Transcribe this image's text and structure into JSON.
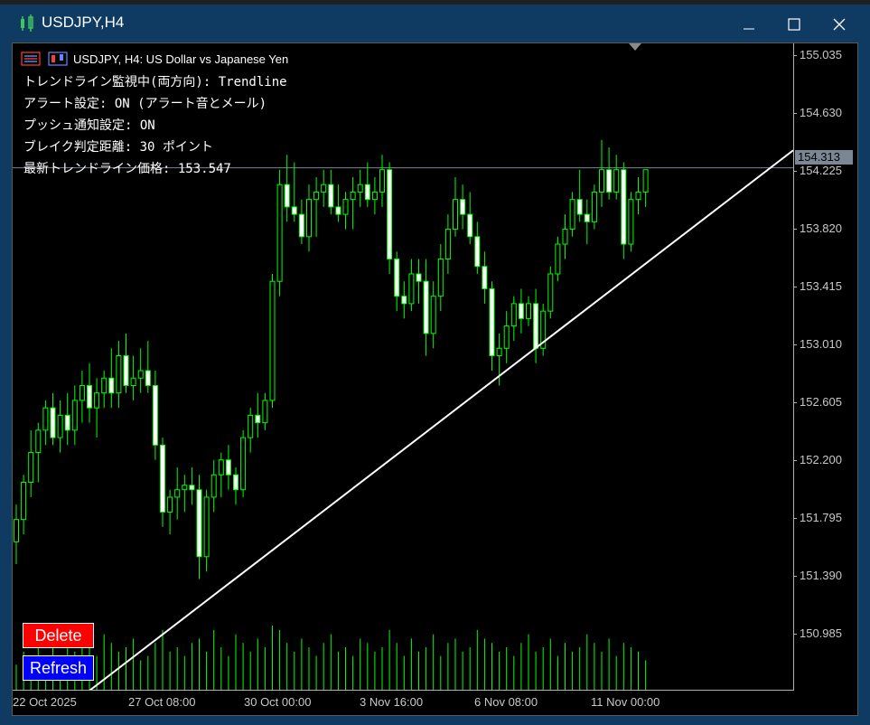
{
  "window": {
    "title": "USDJPY,H4",
    "minimize_icon": "minimize-icon",
    "maximize_icon": "maximize-icon",
    "close_icon": "close-icon"
  },
  "chart": {
    "symbol_line": "USDJPY, H4:  US Dollar vs Japanese Yen",
    "current_price": "154.313",
    "colors": {
      "candle": "#00ff00",
      "trendline": "#ffffff",
      "background": "#000000",
      "volume": "#00ff00"
    }
  },
  "info_lines": [
    "トレンドライン監視中(両方向): Trendline",
    "アラート設定: ON (アラート音とメール)",
    "プッシュ通知設定: ON",
    "ブレイク判定距離: 30 ポイント",
    "最新トレンドライン価格: 153.547"
  ],
  "buttons": {
    "delete": "Delete",
    "refresh": "Refresh"
  },
  "price_axis": [
    "155.035",
    "154.630",
    "154.225",
    "153.820",
    "153.415",
    "153.010",
    "152.605",
    "152.200",
    "151.795",
    "151.390",
    "150.985"
  ],
  "time_axis": [
    "22 Oct 2025",
    "27 Oct 08:00",
    "30 Oct 00:00",
    "3 Nov 16:00",
    "6 Nov 08:00",
    "11 Nov 00:00"
  ],
  "chart_data": {
    "type": "candlestick",
    "series": [
      {
        "ohlc": [
          [
            151.8,
            152.05,
            151.65,
            151.95
          ],
          [
            151.95,
            152.25,
            151.85,
            152.2
          ],
          [
            152.2,
            152.55,
            152.1,
            152.4
          ],
          [
            152.4,
            152.6,
            152.2,
            152.55
          ],
          [
            152.55,
            152.75,
            152.45,
            152.7
          ],
          [
            152.7,
            152.8,
            152.45,
            152.5
          ],
          [
            152.5,
            152.75,
            152.4,
            152.65
          ],
          [
            152.65,
            152.8,
            152.45,
            152.55
          ],
          [
            152.55,
            152.85,
            152.45,
            152.75
          ],
          [
            152.75,
            152.95,
            152.6,
            152.85
          ],
          [
            152.85,
            153.0,
            152.6,
            152.7
          ],
          [
            152.7,
            152.9,
            152.5,
            152.8
          ],
          [
            152.8,
            152.95,
            152.7,
            152.9
          ],
          [
            152.9,
            153.1,
            152.7,
            152.8
          ],
          [
            152.8,
            153.15,
            152.7,
            153.05
          ],
          [
            153.05,
            153.2,
            152.8,
            152.85
          ],
          [
            152.85,
            153.05,
            152.75,
            152.9
          ],
          [
            152.9,
            153.1,
            152.8,
            152.95
          ],
          [
            152.95,
            153.15,
            152.8,
            152.85
          ],
          [
            152.85,
            152.95,
            152.35,
            152.45
          ],
          [
            152.45,
            152.5,
            151.9,
            152.0
          ],
          [
            152.0,
            152.15,
            151.85,
            152.1
          ],
          [
            152.1,
            152.3,
            151.95,
            152.15
          ],
          [
            152.15,
            152.25,
            152.0,
            152.18
          ],
          [
            152.18,
            152.3,
            152.05,
            152.15
          ],
          [
            152.15,
            152.25,
            151.55,
            151.7
          ],
          [
            151.7,
            152.15,
            151.6,
            152.1
          ],
          [
            152.1,
            152.35,
            152.0,
            152.25
          ],
          [
            152.25,
            152.4,
            152.1,
            152.35
          ],
          [
            152.35,
            152.45,
            152.15,
            152.25
          ],
          [
            152.25,
            152.3,
            152.05,
            152.15
          ],
          [
            152.15,
            152.55,
            152.1,
            152.5
          ],
          [
            152.5,
            152.7,
            152.4,
            152.65
          ],
          [
            152.65,
            152.8,
            152.5,
            152.6
          ],
          [
            152.6,
            152.8,
            152.55,
            152.75
          ],
          [
            152.75,
            153.6,
            152.7,
            153.55
          ],
          [
            153.55,
            154.3,
            153.45,
            154.2
          ],
          [
            154.2,
            154.4,
            153.95,
            154.05
          ],
          [
            154.05,
            154.35,
            153.95,
            154.0
          ],
          [
            154.0,
            154.1,
            153.8,
            153.85
          ],
          [
            153.85,
            154.2,
            153.75,
            154.1
          ],
          [
            154.1,
            154.25,
            153.85,
            154.15
          ],
          [
            154.15,
            154.3,
            154.05,
            154.2
          ],
          [
            154.2,
            154.3,
            154.0,
            154.05
          ],
          [
            154.05,
            154.2,
            153.95,
            154.0
          ],
          [
            154.0,
            154.15,
            153.9,
            154.1
          ],
          [
            154.1,
            154.25,
            153.9,
            154.15
          ],
          [
            154.15,
            154.3,
            154.05,
            154.2
          ],
          [
            154.2,
            154.35,
            154.05,
            154.1
          ],
          [
            154.1,
            154.25,
            154.0,
            154.15
          ],
          [
            154.15,
            154.4,
            154.05,
            154.3
          ],
          [
            154.3,
            154.35,
            153.6,
            153.7
          ],
          [
            153.7,
            153.75,
            153.35,
            153.45
          ],
          [
            153.45,
            153.55,
            153.3,
            153.4
          ],
          [
            153.4,
            153.7,
            153.35,
            153.6
          ],
          [
            153.6,
            153.7,
            153.4,
            153.55
          ],
          [
            153.55,
            153.7,
            153.05,
            153.2
          ],
          [
            153.2,
            153.55,
            153.1,
            153.45
          ],
          [
            153.45,
            153.8,
            153.35,
            153.7
          ],
          [
            153.7,
            154.0,
            153.6,
            153.9
          ],
          [
            153.9,
            154.25,
            153.85,
            154.1
          ],
          [
            154.1,
            154.2,
            153.9,
            154.0
          ],
          [
            154.0,
            154.15,
            153.8,
            153.85
          ],
          [
            153.85,
            153.95,
            153.6,
            153.65
          ],
          [
            153.65,
            153.75,
            153.4,
            153.5
          ],
          [
            153.5,
            153.55,
            152.95,
            153.05
          ],
          [
            153.05,
            153.2,
            152.85,
            153.1
          ],
          [
            153.1,
            153.35,
            153.0,
            153.25
          ],
          [
            153.25,
            153.45,
            153.15,
            153.4
          ],
          [
            153.4,
            153.5,
            153.2,
            153.3
          ],
          [
            153.3,
            153.45,
            153.25,
            153.4
          ],
          [
            153.4,
            153.5,
            153.0,
            153.1
          ],
          [
            153.1,
            153.4,
            153.05,
            153.35
          ],
          [
            153.35,
            153.65,
            153.3,
            153.6
          ],
          [
            153.6,
            153.85,
            153.55,
            153.8
          ],
          [
            153.8,
            154.0,
            153.7,
            153.9
          ],
          [
            153.9,
            154.15,
            153.85,
            154.1
          ],
          [
            154.1,
            154.3,
            153.95,
            154.0
          ],
          [
            154.0,
            154.1,
            153.8,
            153.95
          ],
          [
            153.95,
            154.2,
            153.9,
            154.15
          ],
          [
            154.15,
            154.5,
            154.05,
            154.3
          ],
          [
            154.3,
            154.45,
            154.1,
            154.15
          ],
          [
            154.15,
            154.4,
            154.1,
            154.3
          ],
          [
            154.3,
            154.35,
            153.7,
            153.8
          ],
          [
            153.8,
            154.15,
            153.75,
            154.1
          ],
          [
            154.1,
            154.25,
            154.0,
            154.15
          ],
          [
            154.15,
            154.3,
            154.05,
            154.3
          ]
        ],
        "volume": [
          30,
          45,
          25,
          50,
          40,
          60,
          35,
          55,
          45,
          70,
          50,
          40,
          65,
          55,
          45,
          50,
          60,
          35,
          40,
          55,
          70,
          45,
          50,
          40,
          55,
          60,
          45,
          70,
          50,
          40,
          65,
          55,
          45,
          60,
          50,
          75,
          70,
          55,
          45,
          60,
          50,
          40,
          55,
          65,
          45,
          50,
          40,
          60,
          55,
          45,
          50,
          70,
          55,
          40,
          60,
          45,
          50,
          65,
          40,
          55,
          60,
          45,
          50,
          70,
          60,
          55,
          45,
          50,
          40,
          55,
          65,
          45,
          50,
          60,
          40,
          55,
          45,
          50,
          65,
          55,
          45,
          60,
          40,
          55,
          50,
          45,
          35
        ]
      }
    ],
    "ylim": [
      150.8,
      155.1
    ],
    "trendline": {
      "from": [
        0,
        150.8
      ],
      "to": [
        93,
        154.4
      ]
    }
  }
}
